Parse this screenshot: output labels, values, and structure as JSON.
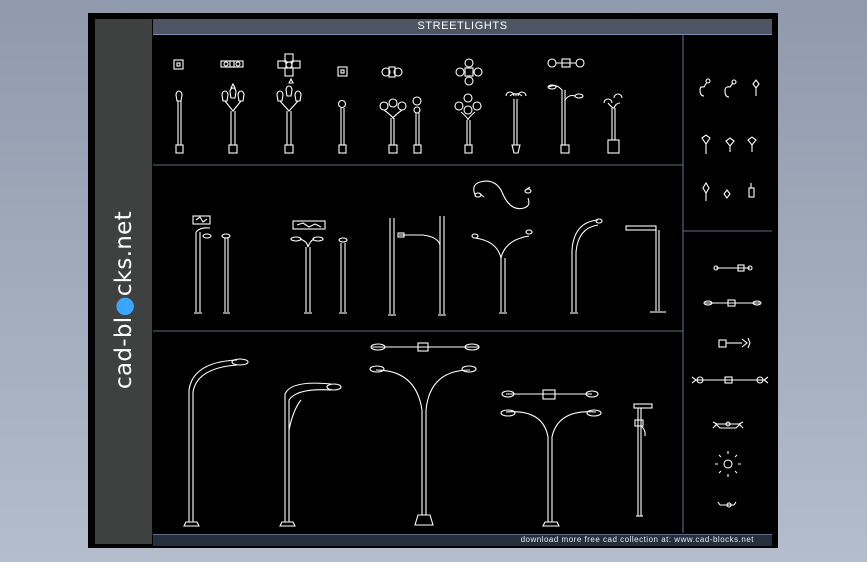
{
  "title": "STREETLIGHTS",
  "brand": {
    "prefix": "cad-bl",
    "dot": "●",
    "suffix": "cks.net"
  },
  "footer": "download more free cad collection at: www.cad-blocks.net",
  "colors": {
    "background": "#a2adbd",
    "canvas": "#000000",
    "sidebar": "#3f4140",
    "lines": "#ffffff",
    "accent": "#3aa6ff"
  }
}
